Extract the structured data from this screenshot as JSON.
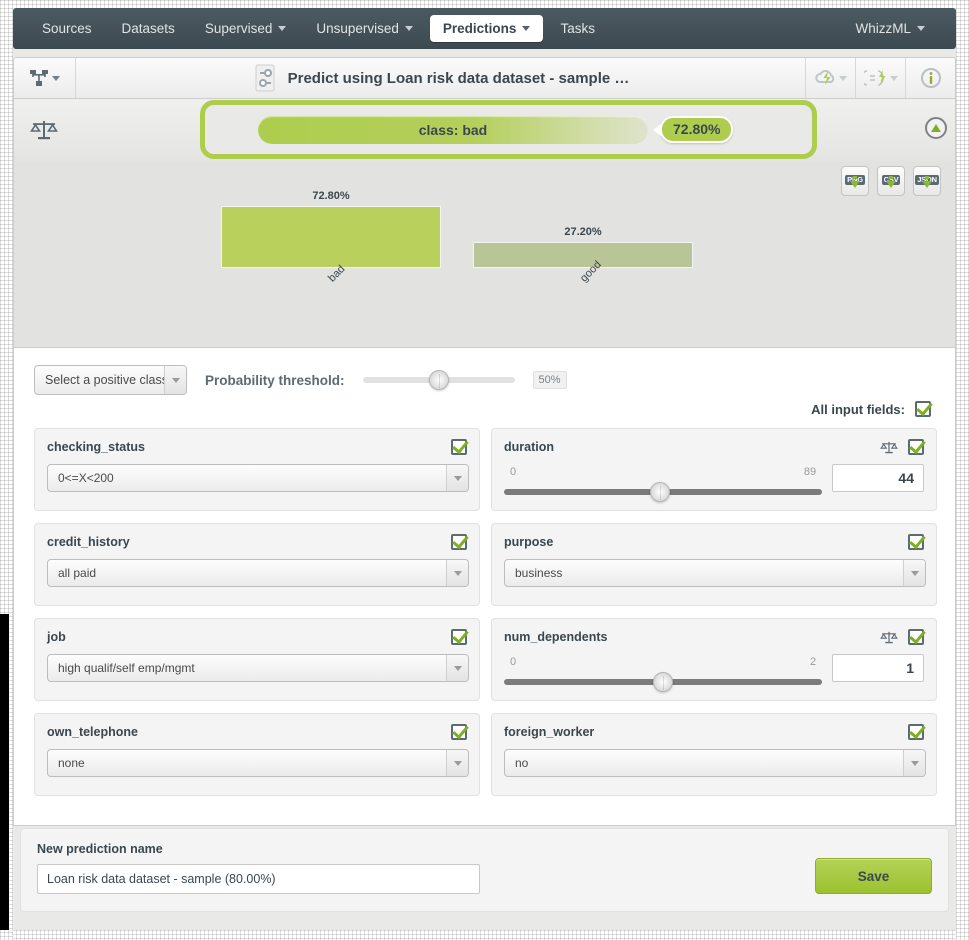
{
  "navbar": {
    "items": [
      {
        "label": "Sources",
        "has_caret": false,
        "active": false
      },
      {
        "label": "Datasets",
        "has_caret": false,
        "active": false
      },
      {
        "label": "Supervised",
        "has_caret": true,
        "active": false
      },
      {
        "label": "Unsupervised",
        "has_caret": true,
        "active": false
      },
      {
        "label": "Predictions",
        "has_caret": true,
        "active": true
      },
      {
        "label": "Tasks",
        "has_caret": false,
        "active": false
      }
    ],
    "right_item": {
      "label": "WhizzML",
      "has_caret": true
    }
  },
  "titlebar": {
    "title": "Predict using Loan risk data dataset - sample …",
    "left_icon": "model-tree-icon",
    "title_icon": "sliders-icon",
    "right_icons": [
      "lightning-cloud-icon",
      "batch-prediction-icon",
      "info-icon"
    ]
  },
  "prediction": {
    "scale_icon": "balance-scale-icon",
    "class_label": "class: bad",
    "probability": "72.80%",
    "collapse_icon": "collapse-circle-icon"
  },
  "chart_panel": {
    "exports": [
      {
        "label": "PNG",
        "name": "export-png-button"
      },
      {
        "label": "CSV",
        "name": "export-csv-button"
      },
      {
        "label": "JSON",
        "name": "export-json-button"
      }
    ]
  },
  "chart_data": {
    "type": "bar",
    "title": "",
    "xlabel": "",
    "ylabel": "",
    "categories": [
      "bad",
      "good"
    ],
    "values": [
      72.8,
      27.2
    ],
    "value_labels": [
      "72.80%",
      "27.20%"
    ],
    "ylim": [
      0,
      100
    ],
    "grid": false,
    "legend": "none",
    "colors": [
      "#bad05c",
      "#b9c497"
    ]
  },
  "controls": {
    "positive_class_placeholder": "Select a positive class",
    "threshold_label": "Probability threshold:",
    "threshold_value": "50%",
    "threshold_percent": 50,
    "all_input_fields_label": "All input fields:"
  },
  "fields": [
    {
      "name": "checking_status",
      "type": "select",
      "value": "0<=X<200",
      "checked": true,
      "has_scale_icon": false
    },
    {
      "name": "duration",
      "type": "number",
      "min": "0",
      "max": "89",
      "value": "44",
      "knob_percent": 49,
      "checked": true,
      "has_scale_icon": true
    },
    {
      "name": "credit_history",
      "type": "select",
      "value": "all paid",
      "checked": true,
      "has_scale_icon": false
    },
    {
      "name": "purpose",
      "type": "select",
      "value": "business",
      "checked": true,
      "has_scale_icon": false
    },
    {
      "name": "job",
      "type": "select",
      "value": "high qualif/self emp/mgmt",
      "checked": true,
      "has_scale_icon": false
    },
    {
      "name": "num_dependents",
      "type": "number",
      "min": "0",
      "max": "2",
      "value": "1",
      "knob_percent": 50,
      "checked": true,
      "has_scale_icon": true
    },
    {
      "name": "own_telephone",
      "type": "select",
      "value": "none",
      "checked": true,
      "has_scale_icon": false
    },
    {
      "name": "foreign_worker",
      "type": "select",
      "value": "no",
      "checked": true,
      "has_scale_icon": false
    }
  ],
  "save_panel": {
    "label": "New prediction name",
    "value": "Loan risk data dataset - sample (80.00%)",
    "save_label": "Save"
  },
  "colors": {
    "accent_green": "#aecd4e",
    "bar_primary": "#bad05c",
    "bar_secondary": "#b9c497",
    "nav_dark": "#3c4950",
    "text_dark": "#3b474e"
  }
}
